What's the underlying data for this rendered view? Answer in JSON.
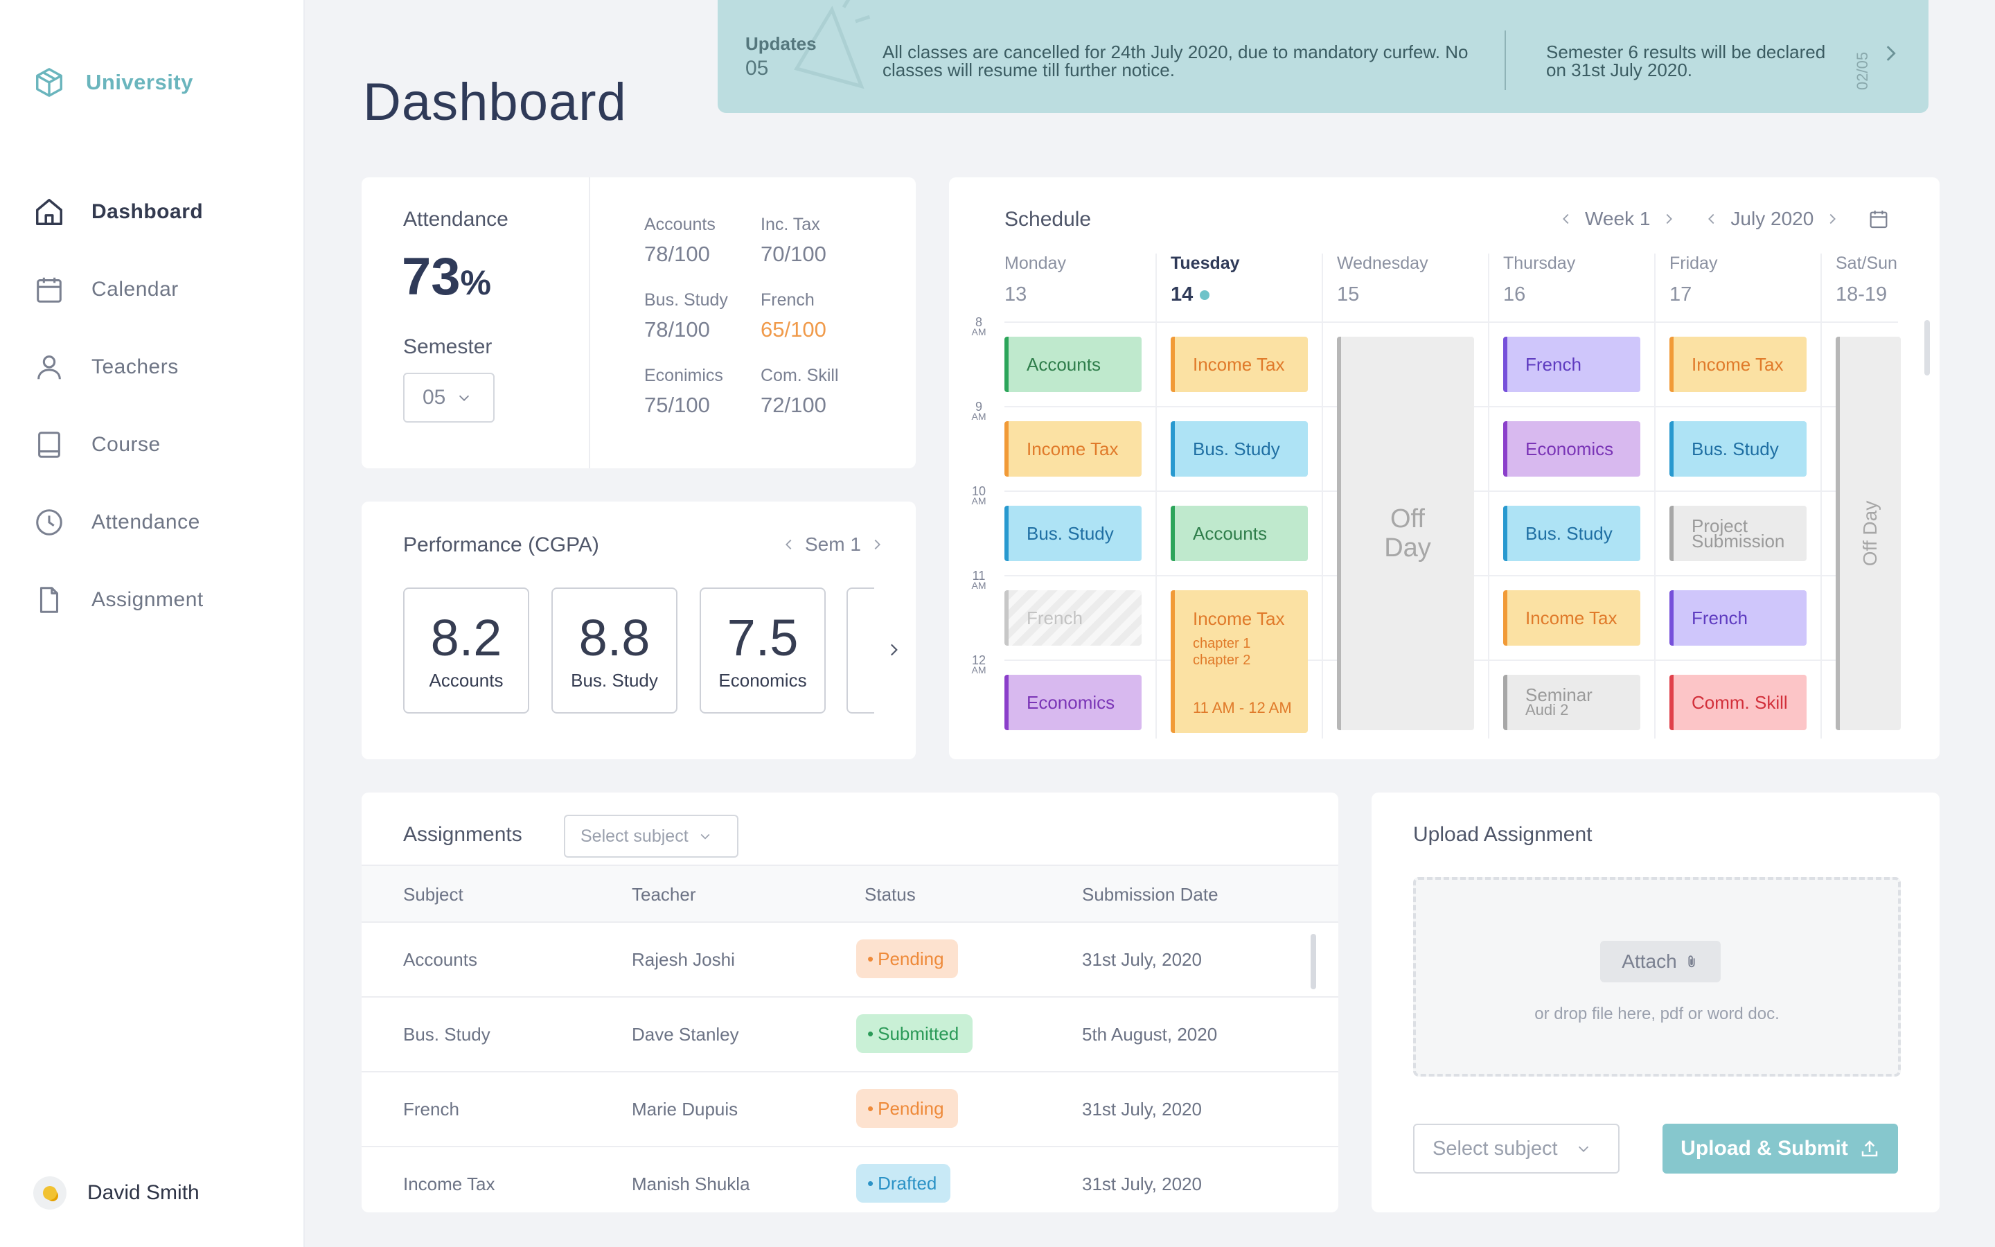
{
  "app": {
    "brand": "University"
  },
  "sidebar": {
    "items": [
      {
        "label": "Dashboard",
        "icon": "home-icon",
        "active": true
      },
      {
        "label": "Calendar",
        "icon": "calendar-icon"
      },
      {
        "label": "Teachers",
        "icon": "user-icon"
      },
      {
        "label": "Course",
        "icon": "book-icon"
      },
      {
        "label": "Attendance",
        "icon": "clock-icon"
      },
      {
        "label": "Assignment",
        "icon": "file-icon"
      }
    ],
    "user": {
      "name": "David Smith"
    }
  },
  "header": {
    "title": "Dashboard"
  },
  "updates": {
    "label": "Updates",
    "count": "05",
    "message1": "All classes are cancelled for 24th July 2020, due to mandatory curfew. No classes will resume till further notice.",
    "message2": "Semester 6 results will be declared on 31st July 2020.",
    "page": "02/05"
  },
  "attendance": {
    "title": "Attendance",
    "value": "73",
    "unit": "%",
    "semester_label": "Semester",
    "semester_value": "05",
    "grades": [
      {
        "name": "Accounts",
        "value": "78/100"
      },
      {
        "name": "Inc. Tax",
        "value": "70/100"
      },
      {
        "name": "Bus. Study",
        "value": "78/100"
      },
      {
        "name": "French",
        "value": "65/100",
        "warn": true
      },
      {
        "name": "Econimics",
        "value": "75/100"
      },
      {
        "name": "Com. Skill",
        "value": "72/100"
      }
    ]
  },
  "performance": {
    "title": "Performance (CGPA)",
    "sem": "Sem 1",
    "items": [
      {
        "value": "8.2",
        "label": "Accounts"
      },
      {
        "value": "8.8",
        "label": "Bus. Study"
      },
      {
        "value": "7.5",
        "label": "Economics"
      }
    ]
  },
  "schedule": {
    "title": "Schedule",
    "week": "Week 1",
    "month": "July 2020",
    "days": [
      {
        "name": "Monday",
        "date": "13"
      },
      {
        "name": "Tuesday",
        "date": "14",
        "today": true
      },
      {
        "name": "Wednesday",
        "date": "15"
      },
      {
        "name": "Thursday",
        "date": "16"
      },
      {
        "name": "Friday",
        "date": "17"
      },
      {
        "name": "Sat/Sun",
        "date": "18-19"
      }
    ],
    "hours": [
      {
        "h": "8",
        "p": "AM"
      },
      {
        "h": "9",
        "p": "AM"
      },
      {
        "h": "10",
        "p": "AM"
      },
      {
        "h": "11",
        "p": "AM"
      },
      {
        "h": "12",
        "p": "AM"
      }
    ],
    "slots": {
      "mon": [
        "Accounts",
        "Income Tax",
        "Bus. Study",
        "French",
        "Economics"
      ],
      "tue": [
        "Income Tax",
        "Bus. Study",
        "Accounts"
      ],
      "tue_long": {
        "title": "Income Tax",
        "sub1": "chapter 1",
        "sub2": "chapter 2",
        "time": "11 AM - 12 AM"
      },
      "wed_off": "Off Day",
      "thu": [
        "French",
        "Economics",
        "Bus. Study",
        "Income Tax"
      ],
      "thu_seminar": {
        "title": "Seminar",
        "sub": "Audi 2"
      },
      "fri": [
        "Income Tax",
        "Bus. Study",
        "French",
        "Comm. Skill"
      ],
      "fri_project": {
        "l1": "Project",
        "l2": "Submission"
      },
      "weekend_off": "Off Day"
    },
    "colors": {
      "accounts": "#2ca55a",
      "income_tax": "#f19a37",
      "bus_study": "#2899cf",
      "economics": "#8b3fca",
      "french": "#7650da",
      "comm_skill": "#e0404a"
    }
  },
  "assignments": {
    "title": "Assignments",
    "filter_placeholder": "Select subject",
    "columns": [
      "Subject",
      "Teacher",
      "Status",
      "Submission Date"
    ],
    "rows": [
      {
        "subject": "Accounts",
        "teacher": "Rajesh Joshi",
        "status": "Pending",
        "date": "31st July, 2020"
      },
      {
        "subject": "Bus. Study",
        "teacher": "Dave Stanley",
        "status": "Submitted",
        "date": "5th August, 2020"
      },
      {
        "subject": "French",
        "teacher": "Marie Dupuis",
        "status": "Pending",
        "date": "31st July, 2020"
      },
      {
        "subject": "Income Tax",
        "teacher": "Manish Shukla",
        "status": "Drafted",
        "date": "31st July, 2020"
      }
    ]
  },
  "upload": {
    "title": "Upload Assignment",
    "attach": "Attach",
    "hint": "or drop file here, pdf or word doc.",
    "select_placeholder": "Select subject",
    "submit": "Upload & Submit"
  },
  "theme": {
    "accent": "#6ab5bd",
    "banner": "#bcdde0",
    "button": "#86c7cd"
  }
}
